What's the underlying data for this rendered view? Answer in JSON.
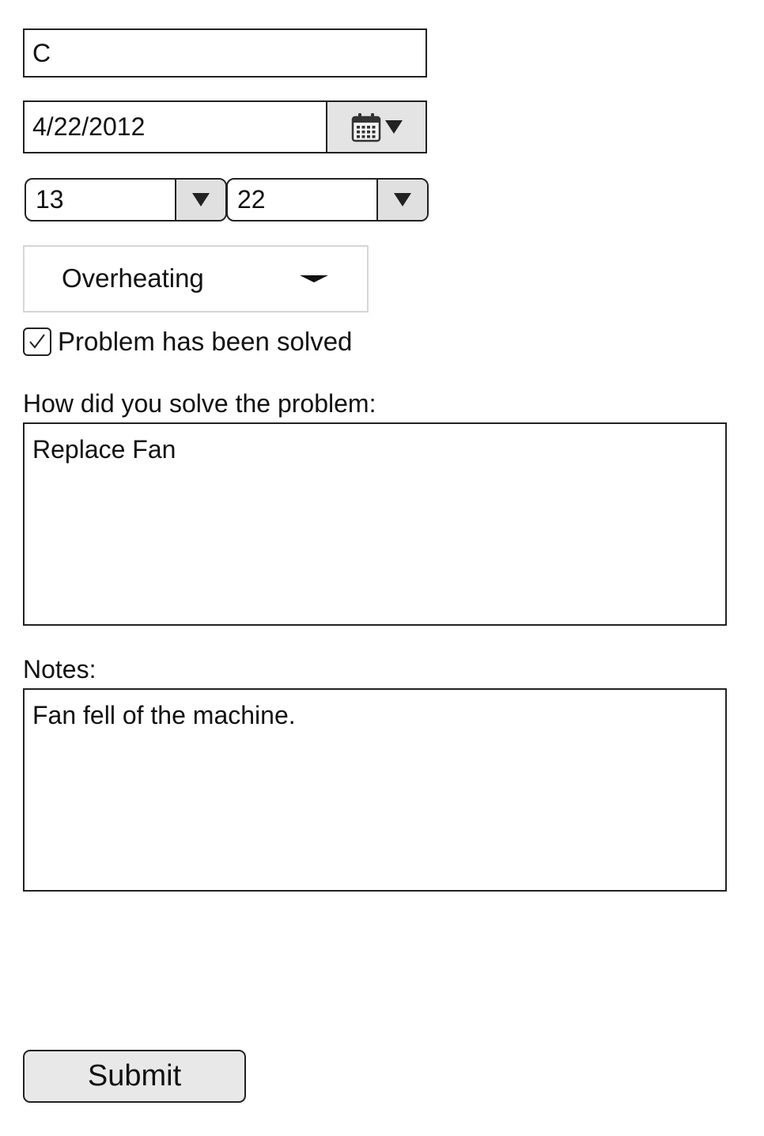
{
  "form": {
    "name_field": {
      "value": "C"
    },
    "date_picker": {
      "value": "4/22/2012",
      "icon": "calendar-icon"
    },
    "time": {
      "hour": "13",
      "minute": "22"
    },
    "problem_dropdown": {
      "selected": "Overheating"
    },
    "solved_checkbox": {
      "checked": true,
      "label": "Problem has been solved"
    },
    "solution": {
      "label": "How did you solve the problem:",
      "value": "Replace Fan"
    },
    "notes": {
      "label": "Notes:",
      "value": "Fan fell of the machine."
    },
    "submit_label": "Submit"
  }
}
